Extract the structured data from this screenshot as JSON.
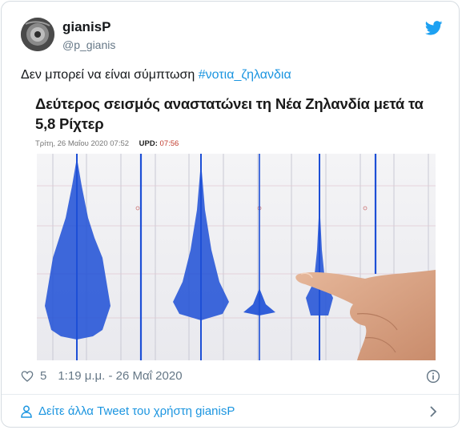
{
  "tweet": {
    "author_name": "gianisP",
    "author_handle": "@p_gianis",
    "text_prefix": "Δεν μπορεί να είναι σύμπτωση ",
    "hashtag": "#νοτια_ζηλανδια",
    "likes": "5",
    "timestamp": "1:19 μ.μ. - 26 Μαΐ 2020",
    "more_tweets_label": "Δείτε άλλα Tweet του χρήστη gianisP"
  },
  "article": {
    "headline": "Δεύτερος σεισμός αναστατώνει τη Νέα Ζηλανδία μετά τα 5,8 Ρίχτερ",
    "date": "Τρίτη, 26 Μαΐου 2020 07:52",
    "upd_label": "UPD:",
    "upd_time": "07:56"
  },
  "icons": {
    "twitter": "twitter-bird-icon",
    "like": "heart-icon",
    "info": "info-icon",
    "person": "person-icon",
    "chevron": "chevron-right-icon"
  },
  "colors": {
    "accent": "#1b95e0",
    "text": "#14171a",
    "muted": "#657786",
    "seismo_ink": "#1a4fd0"
  }
}
